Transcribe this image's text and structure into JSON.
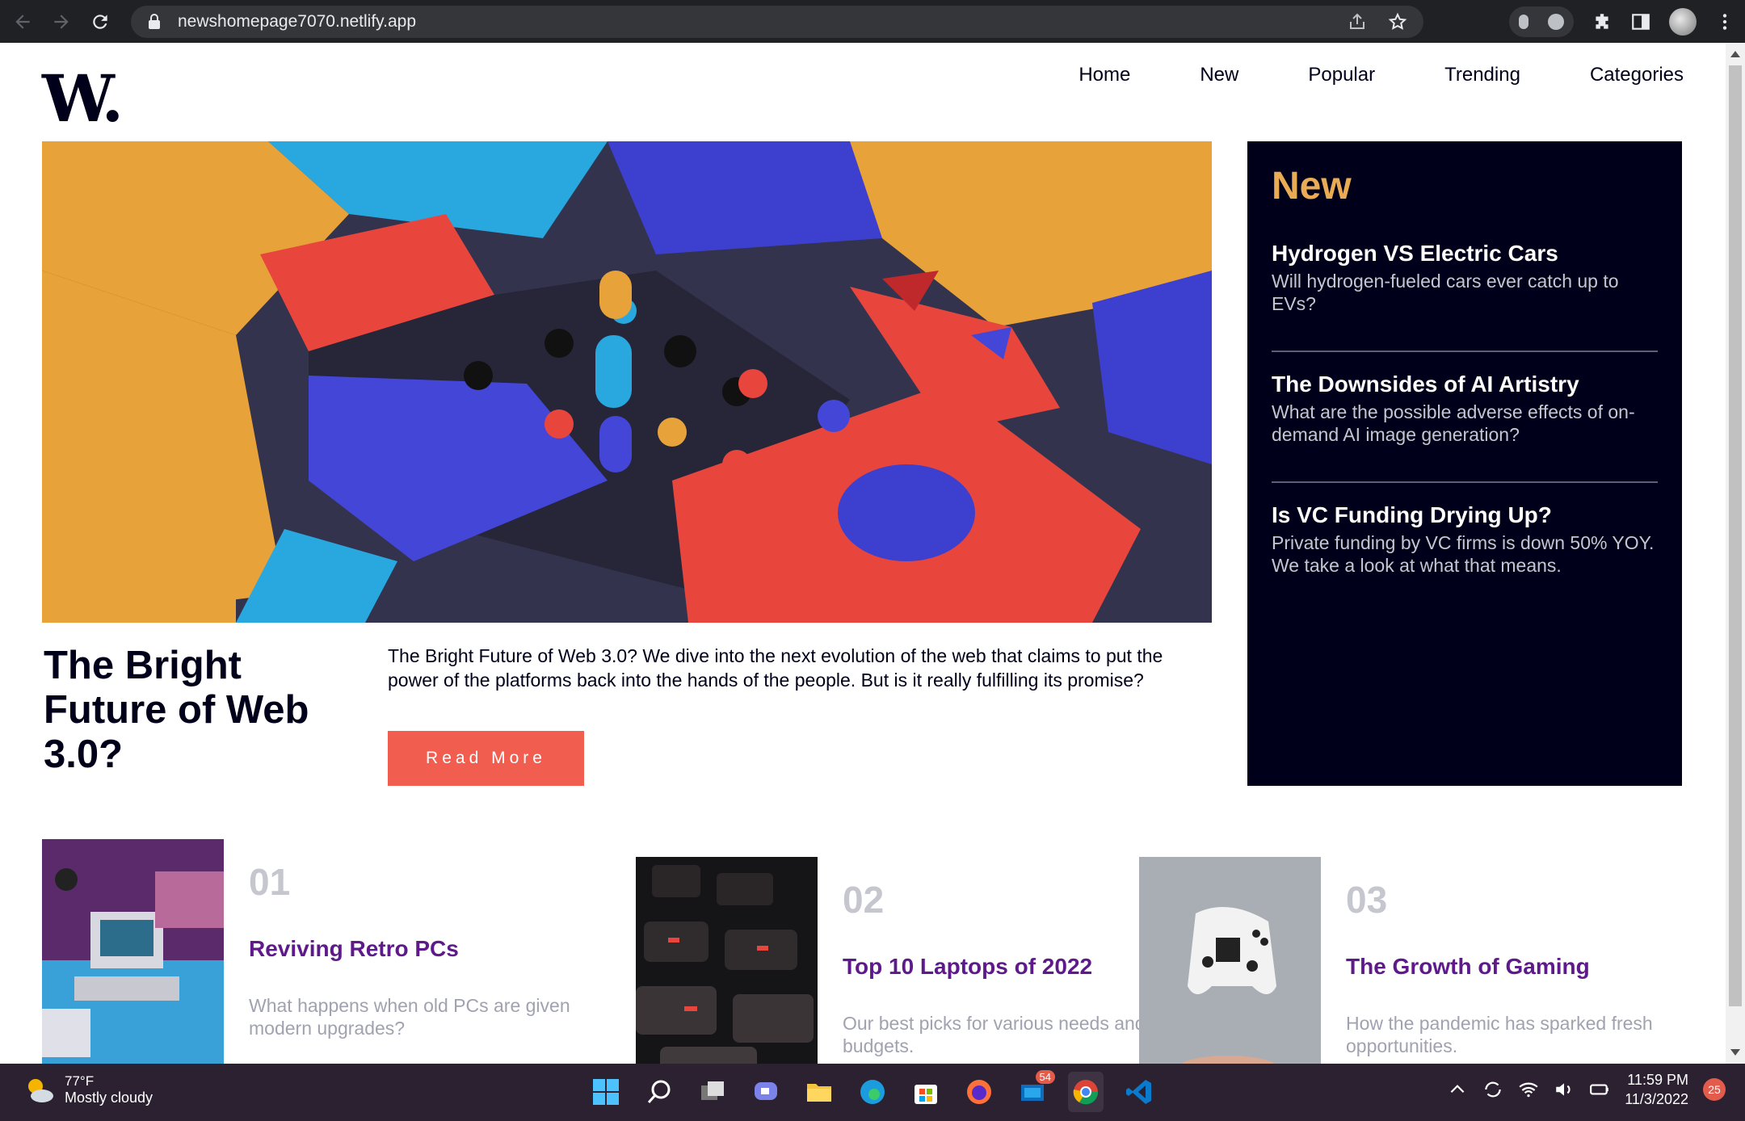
{
  "browser": {
    "url": "newshomepage7070.netlify.app"
  },
  "site": {
    "logo": "W.",
    "nav": [
      "Home",
      "New",
      "Popular",
      "Trending",
      "Categories"
    ]
  },
  "hero": {
    "title": "The Bright Future of Web 3.0?",
    "description": "The Bright Future of Web 3.0? We dive into the next evolution of the web that claims to put the power of the platforms back into the hands of the people. But is it really fulfilling its promise?",
    "button": "Read More"
  },
  "new_panel": {
    "heading": "New",
    "items": [
      {
        "title": "Hydrogen VS Electric Cars",
        "text": "Will hydrogen-fueled cars ever catch up to EVs?"
      },
      {
        "title": "The Downsides of AI Artistry",
        "text": "What are the possible adverse effects of on-demand AI image generation?"
      },
      {
        "title": "Is VC Funding Drying Up?",
        "text": "Private funding by VC firms is down 50% YOY. We take a look at what that means."
      }
    ]
  },
  "cards": [
    {
      "num": "01",
      "title": "Reviving Retro PCs",
      "text": "What happens when old PCs are given modern upgrades?"
    },
    {
      "num": "02",
      "title": "Top 10 Laptops of 2022",
      "text": "Our best picks for various needs and budgets."
    },
    {
      "num": "03",
      "title": "The Growth of Gaming",
      "text": "How the pandemic has sparked fresh opportunities."
    }
  ],
  "taskbar": {
    "temperature": "77°F",
    "condition": "Mostly cloudy",
    "mail_badge": "54",
    "time": "11:59 PM",
    "date": "11/3/2022",
    "notifications": "25"
  },
  "colors": {
    "accent": "#f15e50",
    "panel_bg": "#00001a",
    "panel_heading": "#e9ab53",
    "card_title": "#5e1a8a"
  }
}
